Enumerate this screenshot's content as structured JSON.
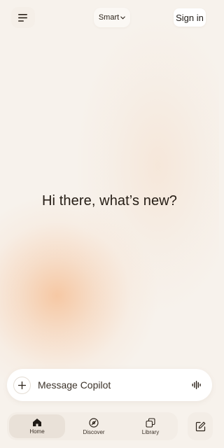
{
  "header": {
    "menu_icon": "hamburger-menu-icon",
    "mode_label": "Smart",
    "mode_icon": "chevron-down-icon",
    "signin_label": "Sign in"
  },
  "main": {
    "greeting": "Hi there, what’s new?"
  },
  "composer": {
    "add_icon": "plus-icon",
    "placeholder": "Message Copilot",
    "voice_icon": "voice-waveform-icon"
  },
  "nav": {
    "items": [
      {
        "label": "Home",
        "icon": "home-icon",
        "active": true
      },
      {
        "label": "Discover",
        "icon": "compass-icon",
        "active": false
      },
      {
        "label": "Library",
        "icon": "library-icon",
        "active": false
      }
    ],
    "compose_icon": "new-chat-icon"
  },
  "colors": {
    "background": "#f7f2ec",
    "accent_glow": "#f6ba8c",
    "text": "#2b2219"
  }
}
